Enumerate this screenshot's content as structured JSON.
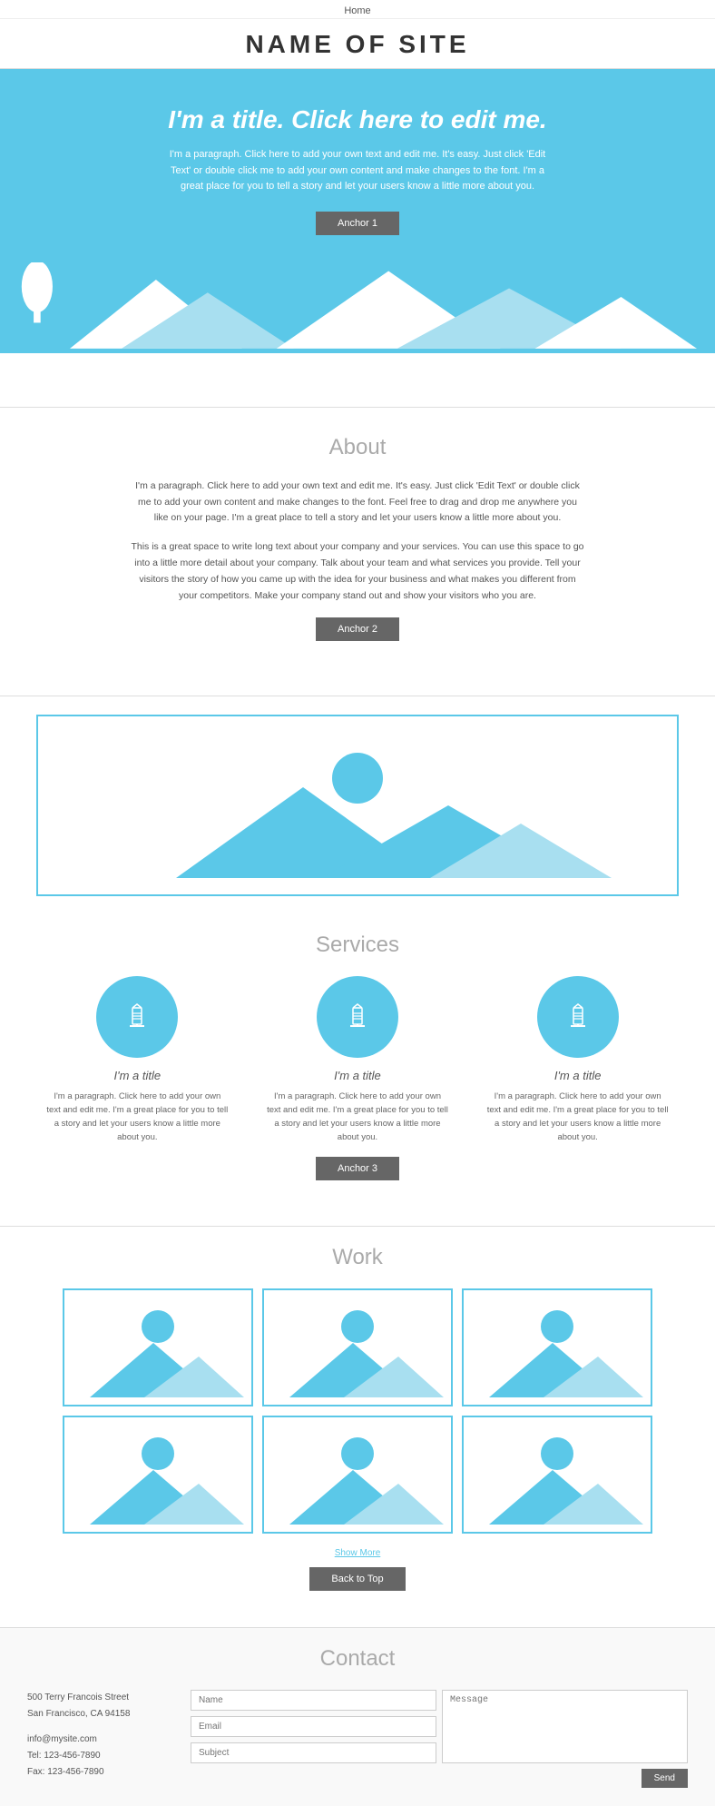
{
  "nav": {
    "home_label": "Home"
  },
  "site": {
    "title": "NAME OF SITE"
  },
  "hero": {
    "title": "I'm a title. Click here to edit me.",
    "paragraph": "I'm a paragraph. Click here to add your own text and edit me. It's easy. Just click 'Edit Text' or double click me to add your own content and make changes to the font. I'm a great place for you to tell a story and let your users know a little more about you.",
    "anchor_label": "Anchor 1"
  },
  "about": {
    "heading": "About",
    "paragraph1": "I'm a paragraph. Click here to add your own text and edit me. It's easy. Just click 'Edit Text' or double click me to add your own content and make changes to the font. Feel free to drag and drop me anywhere you like on your page. I'm a great place to tell a story and let your users know a little more about you.",
    "paragraph2": "This is a great space to write long text about your company and your services. You can use this space to go into a little more detail about your company. Talk about your team and what services you provide. Tell your visitors the story of how you came up with the idea for your business and what makes you different from your competitors. Make your company stand out and show your visitors who you are.",
    "anchor_label": "Anchor 2"
  },
  "services": {
    "heading": "Services",
    "items": [
      {
        "title": "I'm a title",
        "paragraph": "I'm a paragraph. Click here to add your own text and edit me. I'm a great place for you to tell a story and let your users know a little more about you."
      },
      {
        "title": "I'm a title",
        "paragraph": "I'm a paragraph. Click here to add your own text and edit me. I'm a great place for you to tell a story and let your users know a little more about you."
      },
      {
        "title": "I'm a title",
        "paragraph": "I'm a paragraph. Click here to add your own text and edit me. I'm a great place for you to tell a story and let your users know a little more about you."
      }
    ],
    "anchor_label": "Anchor 3"
  },
  "work": {
    "heading": "Work",
    "show_more_label": "Show More",
    "back_to_top_label": "Back to Top"
  },
  "contact": {
    "heading": "Contact",
    "address_line1": "500 Terry Francois Street",
    "address_line2": "San Francisco, CA 94158",
    "email": "info@mysite.com",
    "tel": "Tel: 123-456-7890",
    "fax": "Fax: 123-456-7890",
    "form": {
      "name_placeholder": "Name",
      "email_placeholder": "Email",
      "subject_placeholder": "Subject",
      "message_placeholder": "Message",
      "submit_label": "Send"
    }
  }
}
